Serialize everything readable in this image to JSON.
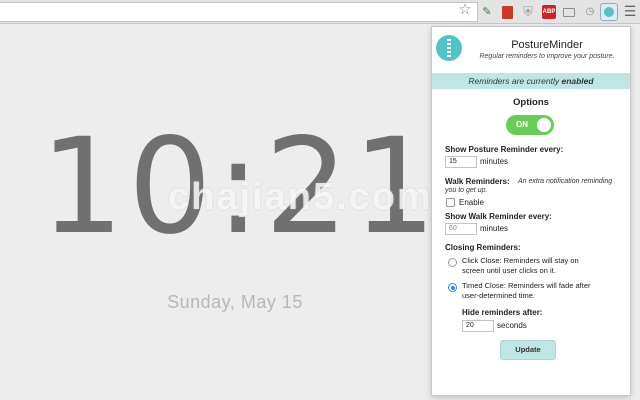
{
  "browser": {
    "icons": [
      "star-icon",
      "pen-icon",
      "book-icon",
      "shield-icon",
      "abp-icon",
      "cast-icon",
      "clock-icon",
      "posture-minder-icon",
      "menu-icon"
    ],
    "abp_label": "ABP"
  },
  "page": {
    "time_h": "10",
    "time_sep": ":",
    "time_m": "21",
    "date": "Sunday, May 15",
    "watermark": "chajian5.com"
  },
  "popup": {
    "title": "PostureMinder",
    "subtitle": "Regular reminders to improve your posture.",
    "banner_prefix": "Reminders are currently",
    "banner_state": "enabled",
    "options_heading": "Options",
    "toggle_label": "ON",
    "toggle_on": true,
    "show_posture_label": "Show Posture Reminder every:",
    "posture_interval": "15",
    "posture_unit": "minutes",
    "walk_label": "Walk Reminders:",
    "walk_note": "An extra notification reminding you to get up.",
    "walk_enable_label": "Enable",
    "walk_enabled": false,
    "show_walk_label": "Show Walk Reminder every:",
    "walk_interval": "60",
    "walk_unit": "minutes",
    "closing_label": "Closing Reminders:",
    "click_close_text": "Click Close: Reminders will stay on screen until user clicks on it.",
    "timed_close_text": "Timed Close: Reminders will fade after user-determined time.",
    "selected_close_mode": "timed",
    "hide_after_label": "Hide reminders after:",
    "hide_after_value": "20",
    "hide_after_unit": "seconds",
    "update_label": "Update"
  },
  "colors": {
    "accent_teal": "#bfe6e4",
    "logo_teal": "#53c3c5",
    "toggle_green": "#6acb58",
    "radio_blue": "#3f84d4"
  }
}
